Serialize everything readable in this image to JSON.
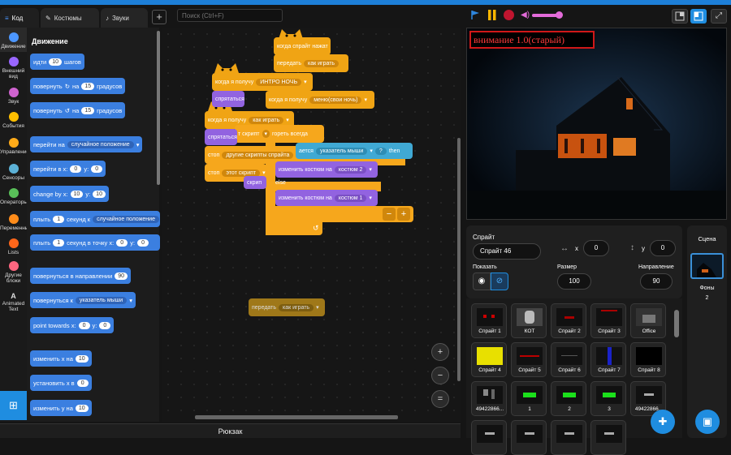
{
  "tabs": {
    "code": "Код",
    "costumes": "Костюмы",
    "sounds": "Звуки",
    "add": "+"
  },
  "search": {
    "placeholder": "Поиск (Ctrl+F)"
  },
  "categories": [
    {
      "label": "Движение",
      "color": "#4c97ff"
    },
    {
      "label": "Внешний вид",
      "color": "#9966ff"
    },
    {
      "label": "Звук",
      "color": "#cf63cf"
    },
    {
      "label": "События",
      "color": "#ffbf00"
    },
    {
      "label": "Управление",
      "color": "#ffab19"
    },
    {
      "label": "Сенсоры",
      "color": "#5cb1d6"
    },
    {
      "label": "Операторы",
      "color": "#59c059"
    },
    {
      "label": "Переменные",
      "color": "#ff8c1a"
    },
    {
      "label": "Lists",
      "color": "#ff661a"
    },
    {
      "label": "Другие блоки",
      "color": "#ff6680"
    },
    {
      "label": "Animated Text",
      "color": "#ffffff"
    }
  ],
  "palette": {
    "title": "Движение",
    "move": {
      "a": "идти",
      "v": "10",
      "b": "шагов"
    },
    "turn_right": {
      "a": "повернуть",
      "b": "на",
      "v": "15",
      "c": "градусов"
    },
    "turn_left": {
      "a": "повернуть",
      "b": "на",
      "v": "15",
      "c": "градусов"
    },
    "goto": {
      "a": "перейти на",
      "d": "случайное положение"
    },
    "goto_xy": {
      "a": "перейти в x:",
      "x": "0",
      "b": "y:",
      "y": "0"
    },
    "change_by": {
      "a": "change by x:",
      "x": "10",
      "b": "y:",
      "y": "10"
    },
    "glide": {
      "a": "плыть",
      "v": "1",
      "b": "секунд к",
      "d": "случайное положение"
    },
    "glide_xy": {
      "a": "плыть",
      "v": "1",
      "b": "секунд в точку x:",
      "x": "0",
      "c": "y:",
      "y": "0"
    },
    "point_dir": {
      "a": "повернуться в направлении",
      "v": "90"
    },
    "point_to": {
      "a": "повернуться к",
      "d": "указатель мыши"
    },
    "point_towards": {
      "a": "point towards x:",
      "x": "0",
      "b": "y:",
      "y": "0"
    },
    "change_x": {
      "a": "изменить х на",
      "v": "10"
    },
    "set_x": {
      "a": "установить х в",
      "v": "0"
    },
    "change_y": {
      "a": "изменить у на",
      "v": "10"
    }
  },
  "script": {
    "b1": "когда спрайт нажат",
    "b2a": "передать",
    "b2d": "как играть",
    "b3a": "когда я получу",
    "b3d": "ИНТРО НОЧЬ",
    "b4": "спрятаться",
    "b5a": "когда я получу",
    "b5d": "меню(свои ночь)",
    "b6a": "когда я получу",
    "b6d": "как играть",
    "b7a": "т скрипт",
    "b7b": "гореть всегда",
    "b8": "спрятаться",
    "b9a": "стоп",
    "b9d": "другие скрипты спрайта",
    "b10a": "ается",
    "b10d": "указатель мыши",
    "b10q": "?",
    "b10t": "then",
    "b11a": "стоп",
    "b11d": "этот скрипт",
    "b12a": "изменить костюм на",
    "b12d": "костюм 2",
    "b13": "скрип",
    "b14": "else",
    "b15a": "изменить костюм на",
    "b15d": "костюм 1",
    "b16a": "−",
    "b16b": "+",
    "loose_a": "передать",
    "loose_d": "как играть"
  },
  "zoom": {
    "in": "+",
    "out": "−",
    "reset": "="
  },
  "backpack": "Рюкзак",
  "stage": {
    "banner": "внимание 1.0(старый)"
  },
  "sprite": {
    "label": "Спрайт",
    "name": "Спрайт 46",
    "x_label": "x",
    "x": "0",
    "y_label": "y",
    "y": "0",
    "show_label": "Показать",
    "size_label": "Размер",
    "size": "100",
    "dir_label": "Направление",
    "dir": "90"
  },
  "sprites": [
    "Спрайт 1",
    "КОТ",
    "Спрайт 2",
    "Спрайт 3",
    "Office",
    "Спрайт 4",
    "Спрайт 5",
    "Спрайт 6",
    "Спрайт 7",
    "Спрайт 8",
    "49422866...",
    "1",
    "2",
    "3",
    "49422866..."
  ],
  "scene": {
    "title": "Сцена",
    "backdrops_label": "Фоны",
    "backdrops": "2"
  },
  "colors": {
    "accent": "#1d7fd8",
    "events": "#f0a414",
    "looks": "#9263e0",
    "motion": "#3b7fe0",
    "sensing": "#40a9d4",
    "banner_text": "#ff3b3b"
  }
}
